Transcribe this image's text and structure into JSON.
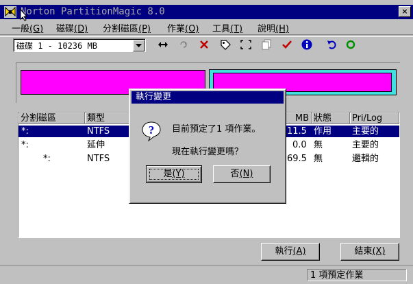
{
  "window": {
    "title": "Norton PartitionMagic 8.0",
    "close_symbol": "×"
  },
  "menu": [
    {
      "label": "一般",
      "key": "(G)"
    },
    {
      "label": "磁碟",
      "key": "(D)"
    },
    {
      "label": "分割磁區",
      "key": "(P)"
    },
    {
      "label": "作業",
      "key": "(O)"
    },
    {
      "label": "工具",
      "key": "(T)"
    },
    {
      "label": "說明",
      "key": "(H)"
    }
  ],
  "toolbar": {
    "disk_selector_value": "磁碟  1 - 10236  MB",
    "icons": [
      "resize-icon",
      "copy-icon",
      "delete-icon",
      "label-icon",
      "resize-move-icon",
      "properties-icon",
      "check-icon",
      "info-icon",
      "undo-icon",
      "apply-icon"
    ]
  },
  "table": {
    "headers": [
      "分割磁區",
      "類型",
      "",
      "",
      "MB",
      "狀態",
      "Pri/Log"
    ],
    "rows": [
      {
        "partition": "*:",
        "type": "NTFS",
        "mb": "11.5",
        "status": "作用",
        "prilog": "主要的",
        "selected": true
      },
      {
        "partition": "*:",
        "type": "延伸",
        "mb": "0.0",
        "status": "無",
        "prilog": "主要的",
        "selected": false
      },
      {
        "partition": "*:",
        "type": "NTFS",
        "mb": "69.5",
        "status": "無",
        "prilog": "邏輯的",
        "selected": false
      }
    ]
  },
  "buttons": {
    "execute": {
      "label": "執行",
      "key": "(A)"
    },
    "exit": {
      "label": "結束",
      "key": "(X)"
    }
  },
  "status": {
    "text": "1 項預定作業"
  },
  "dialog": {
    "title": "執行變更",
    "message1": "目前預定了1 項作業。",
    "message2": "現在執行變更嗎？",
    "yes": {
      "label": "是",
      "key": "(Y)"
    },
    "no": {
      "label": "否",
      "key": "(N)"
    }
  },
  "colors": {
    "titlebar": "#000080",
    "partition_primary": "#ff00ff",
    "partition_extended": "#40e0e0"
  }
}
